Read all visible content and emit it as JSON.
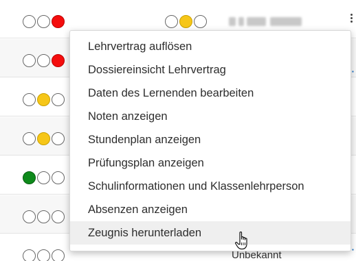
{
  "rows": [
    {
      "lights": [
        "empty",
        "empty",
        "red"
      ],
      "lights2": [
        "empty",
        "yellow",
        "empty"
      ]
    },
    {
      "lights": [
        "empty",
        "empty",
        "red"
      ]
    },
    {
      "lights": [
        "empty",
        "yellow",
        "empty"
      ]
    },
    {
      "lights": [
        "empty",
        "yellow",
        "empty"
      ]
    },
    {
      "lights": [
        "green",
        "empty",
        "empty"
      ]
    },
    {
      "lights": [
        "empty",
        "empty",
        "empty"
      ]
    },
    {
      "lights": [
        "empty",
        "empty",
        "empty"
      ],
      "status": "Unbekannt"
    }
  ],
  "context_menu": {
    "items": [
      "Lehrvertrag auflösen",
      "Dossiereinsicht Lehrvertrag",
      "Daten des Lernenden bearbeiten",
      "Noten anzeigen",
      "Stundenplan anzeigen",
      "Prüfungsplan anzeigen",
      "Schulinformationen und Klassenlehrperson",
      "Absenzen anzeigen",
      "Zeugnis herunterladen"
    ],
    "hovered_item": "Zeugnis herunterladen"
  },
  "icons": {
    "row_menu": "kebab-icon",
    "cursor": "hand-pointer-icon"
  },
  "colors": {
    "red": "#f40d0d",
    "yellow": "#f6c618",
    "green": "#0e8a1b",
    "hover": "#efefef"
  }
}
